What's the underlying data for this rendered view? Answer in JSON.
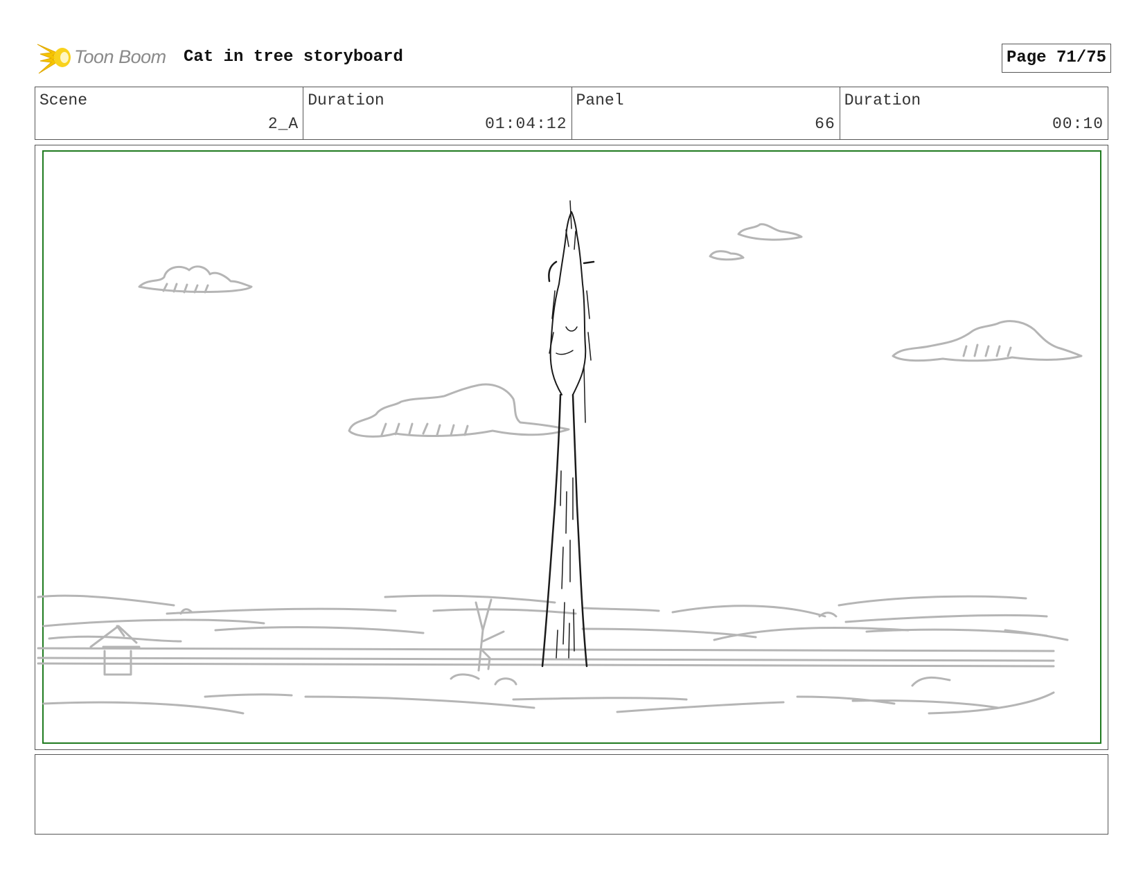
{
  "header": {
    "brand": "Toon Boom",
    "title": "Cat in tree storyboard",
    "page": "Page 71/75"
  },
  "info": {
    "scene_label": "Scene",
    "scene_value": "2_A",
    "scene_duration_label": "Duration",
    "scene_duration_value": "01:04:12",
    "panel_label": "Panel",
    "panel_value": "66",
    "panel_duration_label": "Duration",
    "panel_duration_value": "00:10"
  },
  "colors": {
    "safe_frame": "#1f7a1f",
    "sketch_gray": "#b5b5b5",
    "sketch_ink": "#1a1a1a",
    "logo_yellow": "#f5c400"
  },
  "notes": {
    "text": ""
  }
}
